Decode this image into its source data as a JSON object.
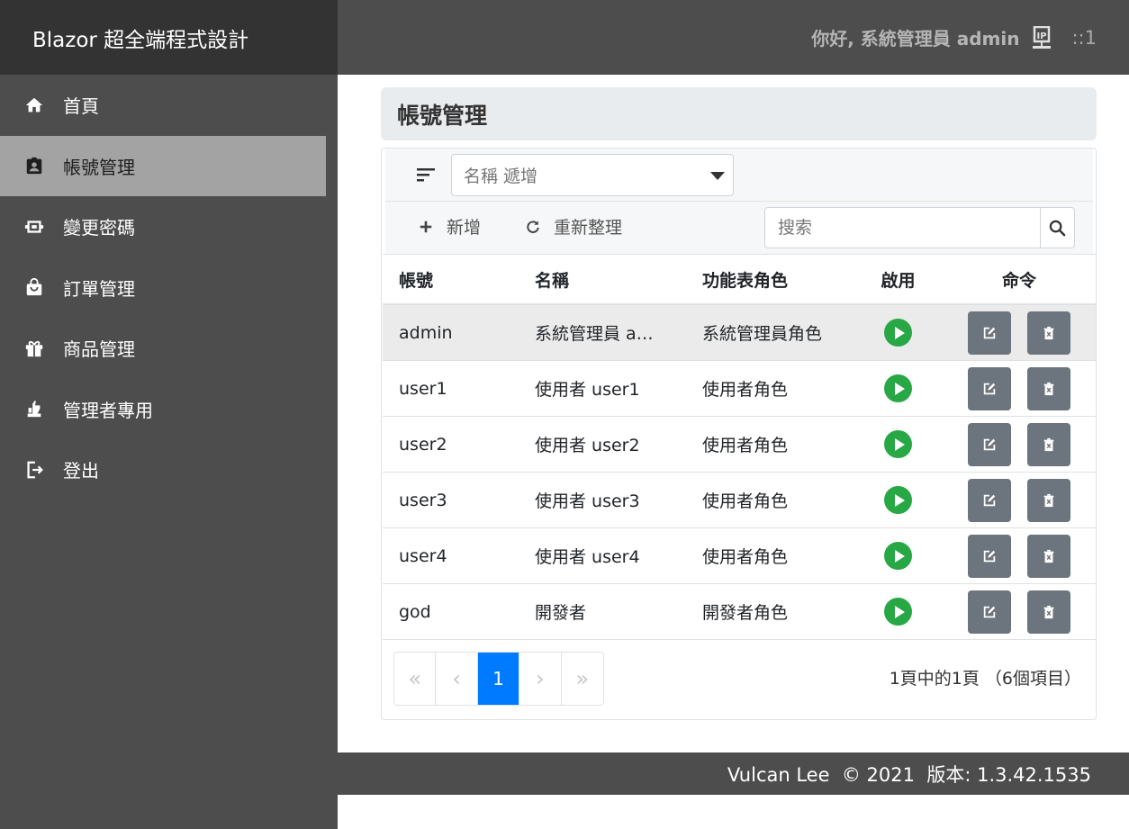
{
  "brand": "Blazor 超全端程式設計",
  "header": {
    "greeting": "你好, 系統管理員 admin",
    "ip_icon": "ip-address-icon",
    "online_count": "::1"
  },
  "sidebar": {
    "items": [
      {
        "label": "首頁",
        "icon": "home-icon"
      },
      {
        "label": "帳號管理",
        "icon": "account-badge-icon",
        "active": true
      },
      {
        "label": "變更密碼",
        "icon": "key-icon"
      },
      {
        "label": "訂單管理",
        "icon": "shopping-bag-icon"
      },
      {
        "label": "商品管理",
        "icon": "gift-icon"
      },
      {
        "label": "管理者專用",
        "icon": "thumb-icon"
      },
      {
        "label": "登出",
        "icon": "logout-icon"
      }
    ]
  },
  "page": {
    "title": "帳號管理"
  },
  "toolbar": {
    "sort_select_value": "名稱 遞增",
    "add_label": "新增",
    "refresh_label": "重新整理",
    "search_placeholder": "搜索"
  },
  "table": {
    "headers": [
      "帳號",
      "名稱",
      "功能表角色",
      "啟用",
      "命令"
    ],
    "rows": [
      {
        "account": "admin",
        "name": "系統管理員 a…",
        "role": "系統管理員角色",
        "enabled": true
      },
      {
        "account": "user1",
        "name": "使用者 user1",
        "role": "使用者角色",
        "enabled": true
      },
      {
        "account": "user2",
        "name": "使用者 user2",
        "role": "使用者角色",
        "enabled": true
      },
      {
        "account": "user3",
        "name": "使用者 user3",
        "role": "使用者角色",
        "enabled": true
      },
      {
        "account": "user4",
        "name": "使用者 user4",
        "role": "使用者角色",
        "enabled": true
      },
      {
        "account": "god",
        "name": "開發者",
        "role": "開發者角色",
        "enabled": true
      }
    ]
  },
  "pager": {
    "first": "«",
    "prev": "‹",
    "current": "1",
    "next": "›",
    "last": "»",
    "info": "1頁中的1頁 （6個項目）"
  },
  "footer": {
    "text": "Vulcan Lee  © 2021  版本: 1.3.42.1535"
  },
  "colors": {
    "sidebar": "#4d4d4d",
    "brand_bg": "#333333",
    "active_item": "#a3a3a3",
    "enabled": "#28a745",
    "action_button": "#6c757d",
    "pager_active": "#007bff"
  }
}
